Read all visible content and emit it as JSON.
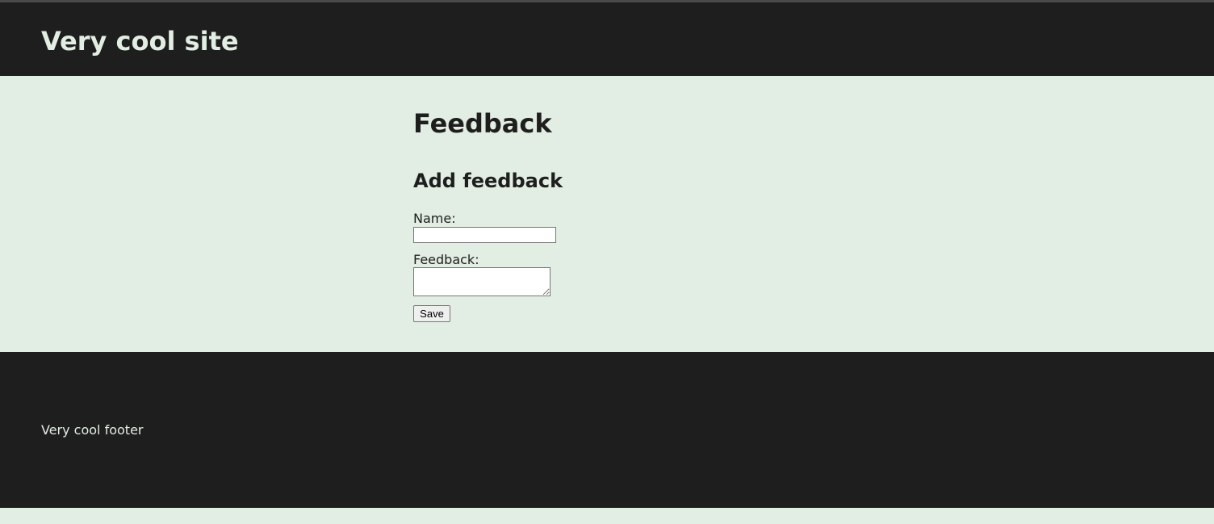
{
  "colors": {
    "dark": "#1e1e1e",
    "light": "#e2ede3"
  },
  "header": {
    "title": "Very cool site"
  },
  "main": {
    "page_title": "Feedback",
    "section_title": "Add feedback",
    "form": {
      "name_label": "Name:",
      "name_value": "",
      "feedback_label": "Feedback:",
      "feedback_value": "",
      "save_label": "Save"
    }
  },
  "footer": {
    "text": "Very cool footer"
  }
}
